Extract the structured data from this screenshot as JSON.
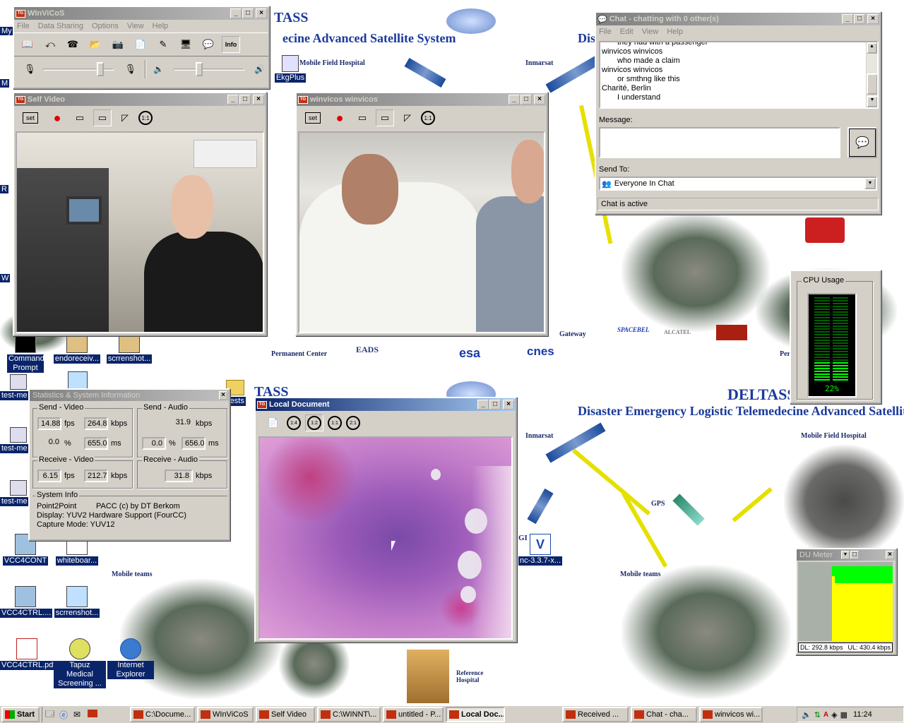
{
  "desktop": {
    "headline_top": "ecine Advanced Satellite System",
    "headline_top_right": "Dis",
    "deltass_top": "TASS",
    "headline_bottom": "Disaster Emergency Logistic Telemedecine Advanced Satellite",
    "deltass_bottom": "DELTASS",
    "deltass_mid": "TASS",
    "logo_deltass": "DELTASS",
    "labels": {
      "mobile_field_hospital": "Mobile Field Hospital",
      "inmarsat": "Inmarsat",
      "inmarsat2": "Inmarsat",
      "gateway": "Gateway",
      "permanent_center": "Permanent Center",
      "perm_short": "Per",
      "eads": "EADS",
      "esa": "esa",
      "cnes": "cnes",
      "spacebel": "SPACEBEL",
      "alcatel": "ALCATEL",
      "mobile_field_hospital2": "Mobile Field Hospital",
      "gps": "GPS",
      "mobile_teams": "Mobile teams",
      "mobile_teams2": "Mobile teams",
      "reference_hospital": "Reference Hospital",
      "gi": "GI"
    }
  },
  "desktop_icons": [
    {
      "label": "Command Prompt",
      "name": "command-prompt"
    },
    {
      "label": "endoreceiv...",
      "name": "endoreceiv"
    },
    {
      "label": "scrrenshot...",
      "name": "scrrenshot1"
    },
    {
      "label": "test-me",
      "name": "test-me-1"
    },
    {
      "label": "test-me",
      "name": "test-me-2"
    },
    {
      "label": "test-me",
      "name": "test-me-3"
    },
    {
      "label": "Tests",
      "name": "tests"
    },
    {
      "label": "VCC4CONT",
      "name": "vcc4cont"
    },
    {
      "label": "whiteboar...",
      "name": "whiteboard"
    },
    {
      "label": "VCC4CTRL....",
      "name": "vcc4ctrl"
    },
    {
      "label": "scrrenshot...",
      "name": "scrrenshot2"
    },
    {
      "label": "VCC4CTRL.pdf",
      "name": "vcc4ctrl-pdf"
    },
    {
      "label": "Tapuz Medical Screening ...",
      "name": "tapuz"
    },
    {
      "label": "Internet Explorer",
      "name": "internet-explorer"
    },
    {
      "label": "EkgPlus",
      "name": "ekgplus"
    },
    {
      "label": "nc-3.3.7-x...",
      "name": "vnc"
    }
  ],
  "edge_letters": {
    "my": "My",
    "m": "M",
    "r": "R",
    "w": "W"
  },
  "winvicos": {
    "title": "WInViCoS",
    "menu": [
      "File",
      "Data Sharing",
      "Options",
      "View",
      "Help"
    ],
    "info_label": "Info",
    "mic_slider_level": 0.85,
    "volume_slider_level": 0.35
  },
  "self_video": {
    "title": "Self Video",
    "set_label": "set",
    "zoom_label": "1:1"
  },
  "remote_video": {
    "title": "winvicos winvicos",
    "set_label": "set",
    "zoom_label": "1:1"
  },
  "chat": {
    "title": "Chat - chatting with 0 other(s)",
    "menu": [
      "File",
      "Edit",
      "View",
      "Help"
    ],
    "log": [
      {
        "text": "they had with a passenger",
        "indent": true
      },
      {
        "text": "winvicos winvicos",
        "indent": false
      },
      {
        "text": "who made a claim",
        "indent": true
      },
      {
        "text": "winvicos winvicos",
        "indent": false
      },
      {
        "text": "or smthng like this",
        "indent": true
      },
      {
        "text": "Charité, Berlin",
        "indent": false
      },
      {
        "text": "I understand",
        "indent": true
      }
    ],
    "message_label": "Message:",
    "message_value": "",
    "send_to_label": "Send To:",
    "send_to_value": "Everyone In Chat",
    "status": "Chat is active"
  },
  "cpu": {
    "label": "CPU Usage",
    "value": "22%",
    "fraction": 0.22
  },
  "stats": {
    "title": "Statistics & System Information",
    "send_video": {
      "label": "Send - Video",
      "fps": "14.88",
      "fps_unit": "fps",
      "kbps": "264.8",
      "kbps_unit": "kbps",
      "loss": "0.0",
      "loss_unit": "%",
      "ms": "655.0",
      "ms_unit": "ms"
    },
    "send_audio": {
      "label": "Send - Audio",
      "kbps": "31.9",
      "kbps_unit": "kbps",
      "loss": "0.0",
      "loss_unit": "%",
      "ms": "656.0",
      "ms_unit": "ms"
    },
    "receive_video": {
      "label": "Receive - Video",
      "fps": "6.15",
      "fps_unit": "fps",
      "kbps": "212.7",
      "kbps_unit": "kbps"
    },
    "receive_audio": {
      "label": "Receive - Audio",
      "kbps": "31.8",
      "kbps_unit": "kbps"
    },
    "system_info": {
      "label": "System Info",
      "point": "Point2Point",
      "pacc": "PACC (c) by DT Berkom",
      "display": "Display: YUV2 Hardware Support (FourCC)",
      "capture": "Capture Mode: YUV12"
    }
  },
  "local_doc": {
    "title": "Local Document",
    "zoom": [
      "1:4",
      "1:2",
      "1:1",
      "2:1"
    ]
  },
  "du_meter": {
    "title": "DU Meter",
    "dl": "DL: 292.8 kbps",
    "ul": "UL: 430.4 kbps"
  },
  "taskbar": {
    "start": "Start",
    "items": [
      {
        "label": "C:\\Docume...",
        "name": "task-documents",
        "active": false
      },
      {
        "label": "WInViCoS",
        "name": "task-winvicos",
        "active": false
      },
      {
        "label": "Self Video",
        "name": "task-self-video",
        "active": false
      },
      {
        "label": "C:\\WINNT\\...",
        "name": "task-winnt",
        "active": false
      },
      {
        "label": "untitled - P...",
        "name": "task-paint",
        "active": false
      },
      {
        "label": "Local Doc...",
        "name": "task-local-doc",
        "active": true
      },
      {
        "label": "Received ...",
        "name": "task-received",
        "active": false
      },
      {
        "label": "Chat - cha...",
        "name": "task-chat",
        "active": false
      },
      {
        "label": "winvicos wi...",
        "name": "task-winvicos-wi",
        "active": false
      }
    ],
    "clock": "11:24"
  }
}
